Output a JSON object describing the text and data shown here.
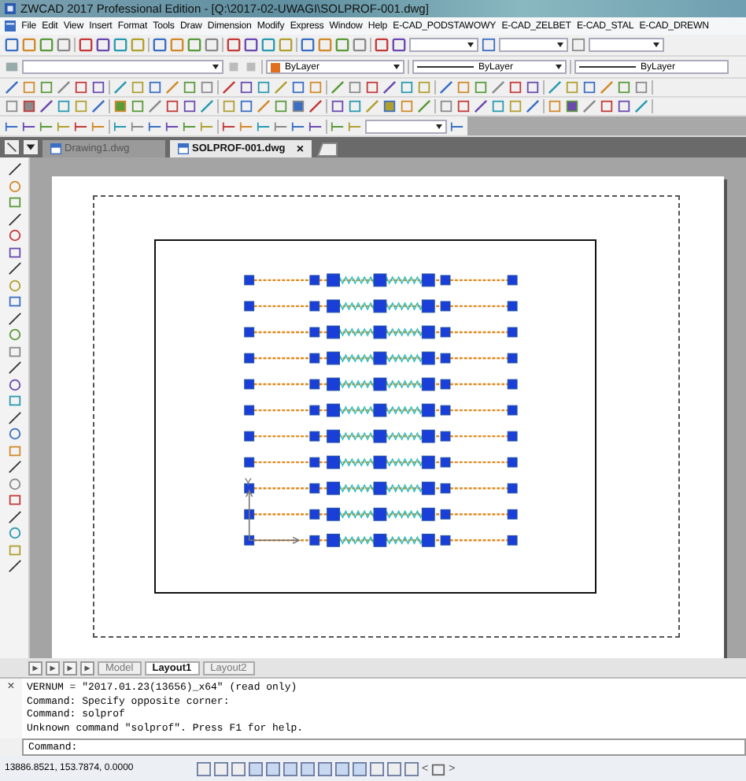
{
  "window": {
    "title": "ZWCAD 2017 Professional Edition - [Q:\\2017-02-UWAGI\\SOLPROF-001.dwg]"
  },
  "menu": [
    "File",
    "Edit",
    "View",
    "Insert",
    "Format",
    "Tools",
    "Draw",
    "Dimension",
    "Modify",
    "Express",
    "Window",
    "Help",
    "E-CAD_PODSTAWOWY",
    "E-CAD_ZELBET",
    "E-CAD_STAL",
    "E-CAD_DREWN"
  ],
  "properties": {
    "color_value": "ByLayer",
    "linetype": "ByLayer",
    "lineweight": "ByLayer"
  },
  "file_tabs": [
    {
      "label": "Drawing1.dwg",
      "selected": false
    },
    {
      "label": "SOLPROF-001.dwg",
      "selected": true
    }
  ],
  "close_glyph": "×",
  "ucs_label": "Y",
  "layout_tabs": [
    {
      "label": "Model",
      "selected": false
    },
    {
      "label": "Layout1",
      "selected": true
    },
    {
      "label": "Layout2",
      "selected": false
    }
  ],
  "command_history": [
    "VERNUM = \"2017.01.23(13656)_x64\" (read only)",
    "Command: Specify opposite corner:",
    "Command: solprof",
    "Unknown command \"solprof\".   Press F1 for help."
  ],
  "command_prompt": "Command:",
  "coordinates": "13886.8521, 153.7874, 0.0000",
  "status_arrows": [
    "<",
    ">"
  ]
}
